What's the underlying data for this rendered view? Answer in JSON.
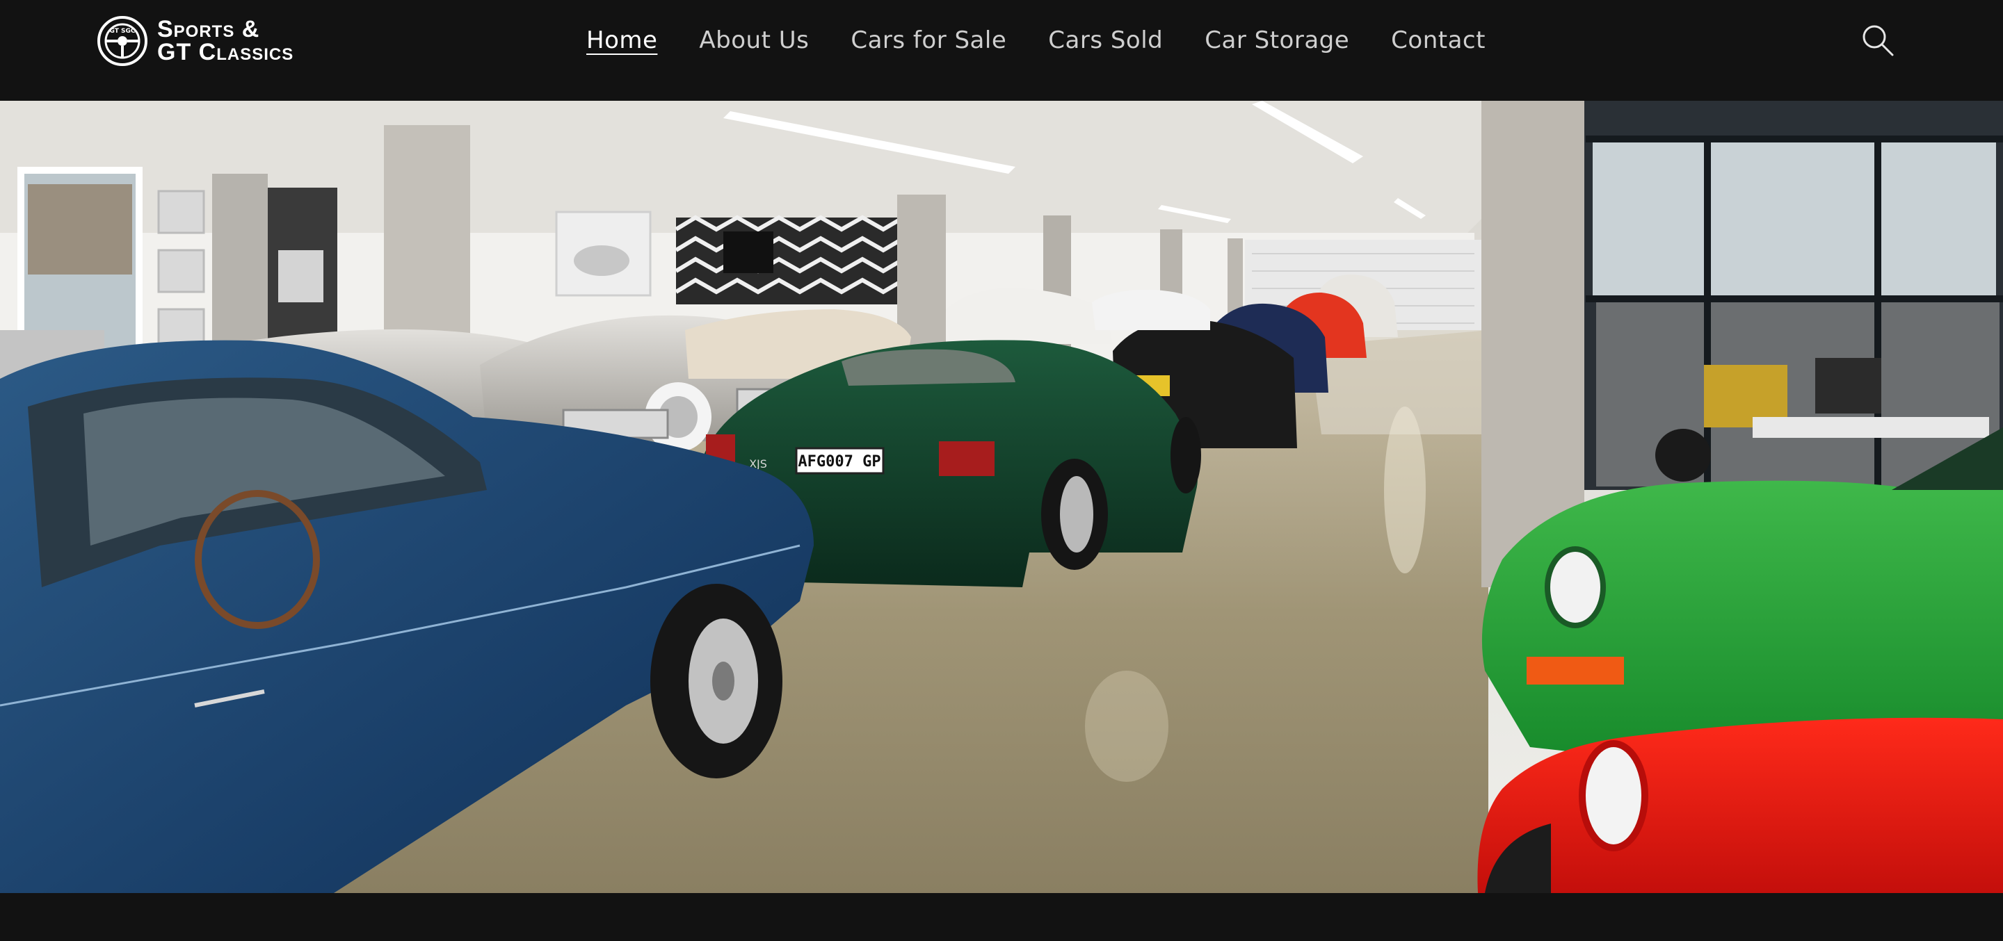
{
  "brand": {
    "line1": "Sports &",
    "line2": "GT Classics",
    "emblem_text": "GT SGC"
  },
  "nav": {
    "items": [
      {
        "label": "Home",
        "active": true
      },
      {
        "label": "About Us",
        "active": false
      },
      {
        "label": "Cars for Sale",
        "active": false
      },
      {
        "label": "Cars Sold",
        "active": false
      },
      {
        "label": "Car Storage",
        "active": false
      },
      {
        "label": "Contact",
        "active": false
      }
    ]
  },
  "search": {
    "icon": "search-icon"
  },
  "hero": {
    "plate": "AFG007 GP",
    "badge": "XJS"
  },
  "colors": {
    "header_bg": "#121212",
    "nav_text": "#cfcfcf",
    "active_text": "#ffffff"
  }
}
